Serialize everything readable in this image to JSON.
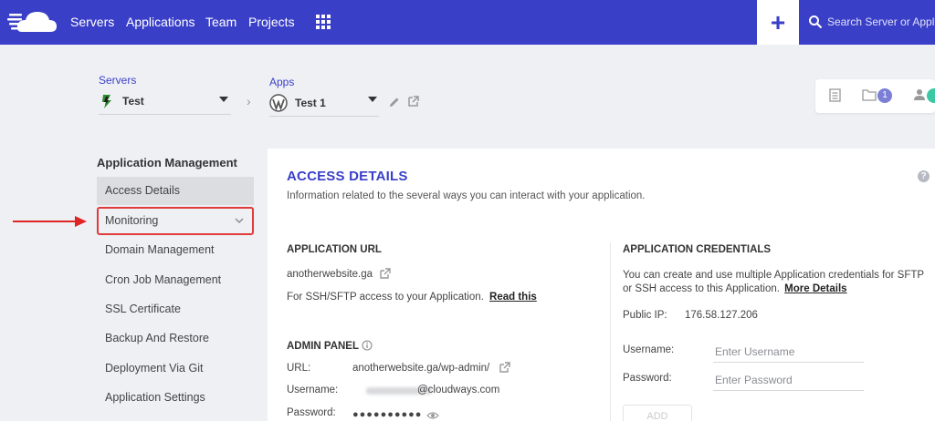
{
  "topnav": {
    "items": [
      "Servers",
      "Applications",
      "Team",
      "Projects"
    ],
    "add_label": "+",
    "search_placeholder": "Search Server or Application",
    "brand_color": "#3a3fc7"
  },
  "breadcrumbs": {
    "servers_label": "Servers",
    "server_value": "Test",
    "apps_label": "Apps",
    "app_value": "Test 1"
  },
  "toolbar": {
    "files_badge": "1"
  },
  "sidebar": {
    "title": "Application Management",
    "items": [
      {
        "label": "Access Details",
        "state": "active"
      },
      {
        "label": "Monitoring",
        "state": "highlighted"
      },
      {
        "label": "Domain Management"
      },
      {
        "label": "Cron Job Management"
      },
      {
        "label": "SSL Certificate"
      },
      {
        "label": "Backup And Restore"
      },
      {
        "label": "Deployment Via Git"
      },
      {
        "label": "Application Settings"
      }
    ]
  },
  "main": {
    "title": "ACCESS DETAILS",
    "subtitle": "Information related to the several ways you can interact with your application.",
    "app_url": {
      "heading": "APPLICATION URL",
      "url": "anotherwebsite.ga",
      "ssh_text": "For SSH/SFTP access to your Application.",
      "ssh_link": "Read this"
    },
    "admin_panel": {
      "heading": "ADMIN PANEL",
      "url_label": "URL:",
      "url_value": "anotherwebsite.ga/wp-admin/",
      "username_label": "Username:",
      "username_suffix": "@cloudways.com",
      "password_label": "Password:",
      "password_mask": "●●●●●●●●●●"
    },
    "credentials": {
      "heading": "APPLICATION CREDENTIALS",
      "desc_line1": "You can create and use multiple Application credentials for SFTP",
      "desc_line2": "or SSH access to this Application.",
      "desc_link": "More Details",
      "public_ip_label": "Public IP:",
      "public_ip_value": "176.58.127.206",
      "username_label": "Username:",
      "username_placeholder": "Enter Username",
      "password_label": "Password:",
      "password_placeholder": "Enter Password",
      "add_button": "ADD"
    }
  }
}
